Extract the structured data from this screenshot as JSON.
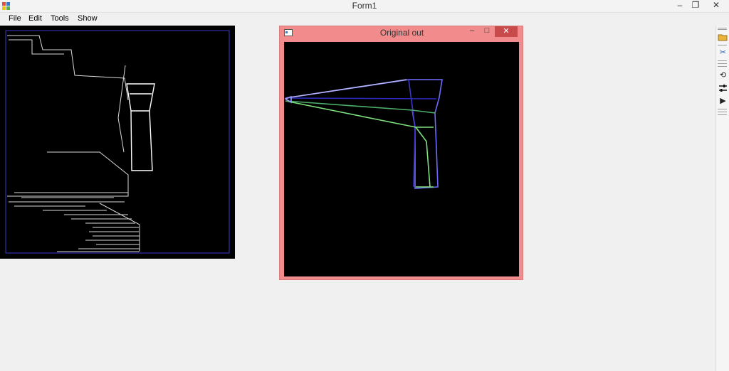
{
  "window": {
    "title": "Form1",
    "icon": "app-icon",
    "controls": {
      "minimize_icon": "minimize-icon",
      "restore_icon": "restore-icon",
      "close_icon": "close-icon"
    }
  },
  "menubar": {
    "items": [
      "File",
      "Edit",
      "Tools",
      "Show"
    ]
  },
  "child_window": {
    "title": "Original out",
    "icon": "child-window-icon",
    "minimize_glyph": "–",
    "maximize_glyph": "□",
    "close_glyph": "✕"
  },
  "toolbar": {
    "icons": [
      "open-folder-icon",
      "cut-icon",
      "refresh-icon",
      "settings-slider-icon",
      "play-icon"
    ]
  },
  "colors": {
    "window_background": "#f0f0f0",
    "canvas_background": "#000000",
    "child_window_frame": "#f28c8c",
    "close_button": "#c94a4a",
    "line_blue": "#3b38c7",
    "line_white": "#ffffff",
    "line_green": "#7ee37e",
    "line_lightblue": "#9aa0ff"
  }
}
